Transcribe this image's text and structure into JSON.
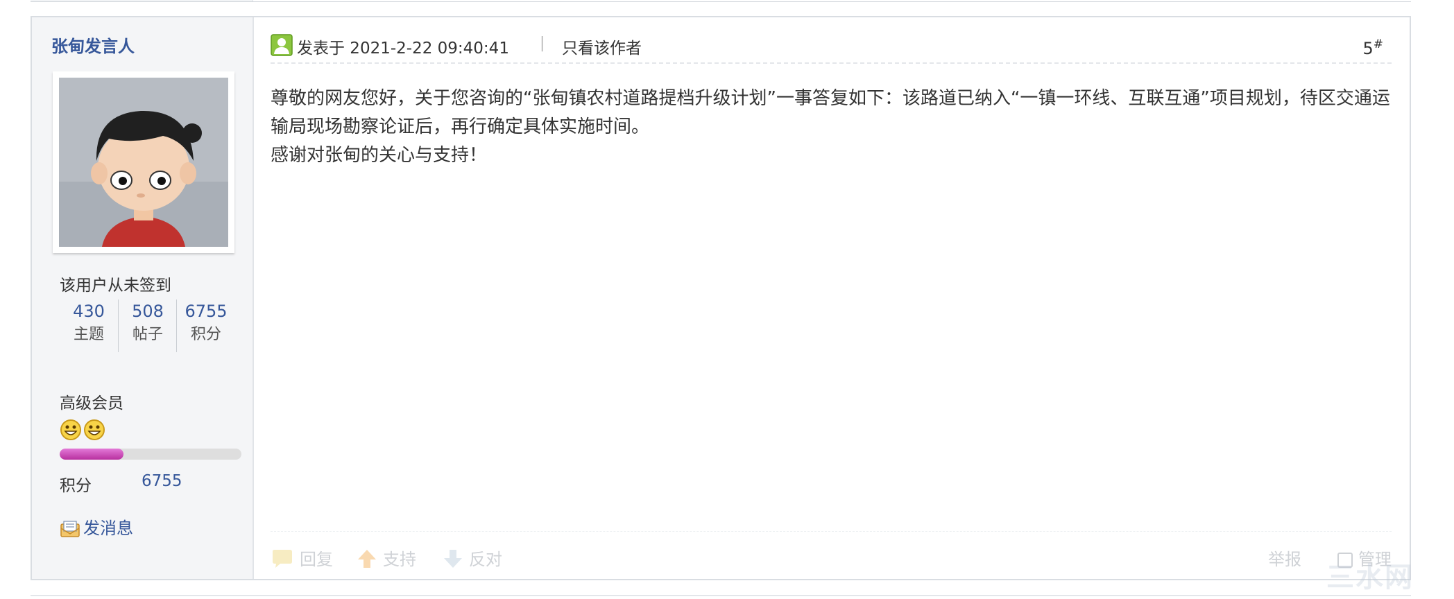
{
  "post": {
    "author": "张甸发言人",
    "signin_status": "该用户从未签到",
    "stats": [
      {
        "value": "430",
        "label": "主题"
      },
      {
        "value": "508",
        "label": "帖子"
      },
      {
        "value": "6755",
        "label": "积分"
      }
    ],
    "level": "高级会员",
    "level_progress_percent": 35,
    "points_label": "积分",
    "points_value": "6755",
    "send_message": "发消息",
    "posted_at": "发表于 2021-2-22 09:40:41",
    "separator": "|",
    "only_author": "只看该作者",
    "floor_number": "5",
    "floor_suffix": "#",
    "body": [
      "尊敬的网友您好，关于您咨询的“张甸镇农村道路提档升级计划”一事答复如下：该路道已纳入“一镇一环线、互联互通”项目规划，待区交通运输局现场勘察论证后，再行确定具体实施时间。",
      "感谢对张甸的关心与支持！"
    ],
    "actions": {
      "reply": "回复",
      "support": "支持",
      "oppose": "反对",
      "report": "举报",
      "manage": "管理"
    }
  },
  "watermark": "三水网",
  "colors": {
    "link_blue": "#36579a",
    "sidebar_bg": "#f4f5f7",
    "progress_fill": "#c84bb8"
  }
}
